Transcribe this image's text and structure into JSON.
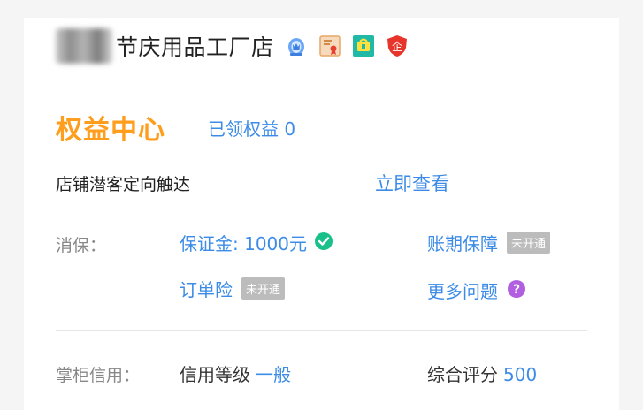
{
  "store": {
    "name": "节庆用品工厂店",
    "badges": [
      "crown-icon",
      "certificate-icon",
      "shop-icon",
      "enterprise-shield-icon"
    ],
    "enterprise_badge_text": "企"
  },
  "rights": {
    "title": "权益中心",
    "received": "已领权益 0"
  },
  "reach": {
    "label": "店铺潜客定向触达",
    "action": "立即查看"
  },
  "consumer_protection": {
    "label": "消保：",
    "deposit": "保证金: 1000元",
    "period_guarantee": "账期保障",
    "period_status": "未开通",
    "order_insurance": "订单险",
    "order_status": "未开通",
    "more_questions": "更多问题"
  },
  "credit": {
    "label": "掌柜信用：",
    "level_label": "信用等级",
    "level_value": "一般",
    "score_label": "综合评分",
    "score_value": "500"
  },
  "colors": {
    "accent_blue": "#3c8ce7",
    "rights_orange": "#ff9d1c",
    "check_green": "#19c08a",
    "question_purple": "#b15fe0",
    "pill_grey": "#bcbcbc"
  }
}
